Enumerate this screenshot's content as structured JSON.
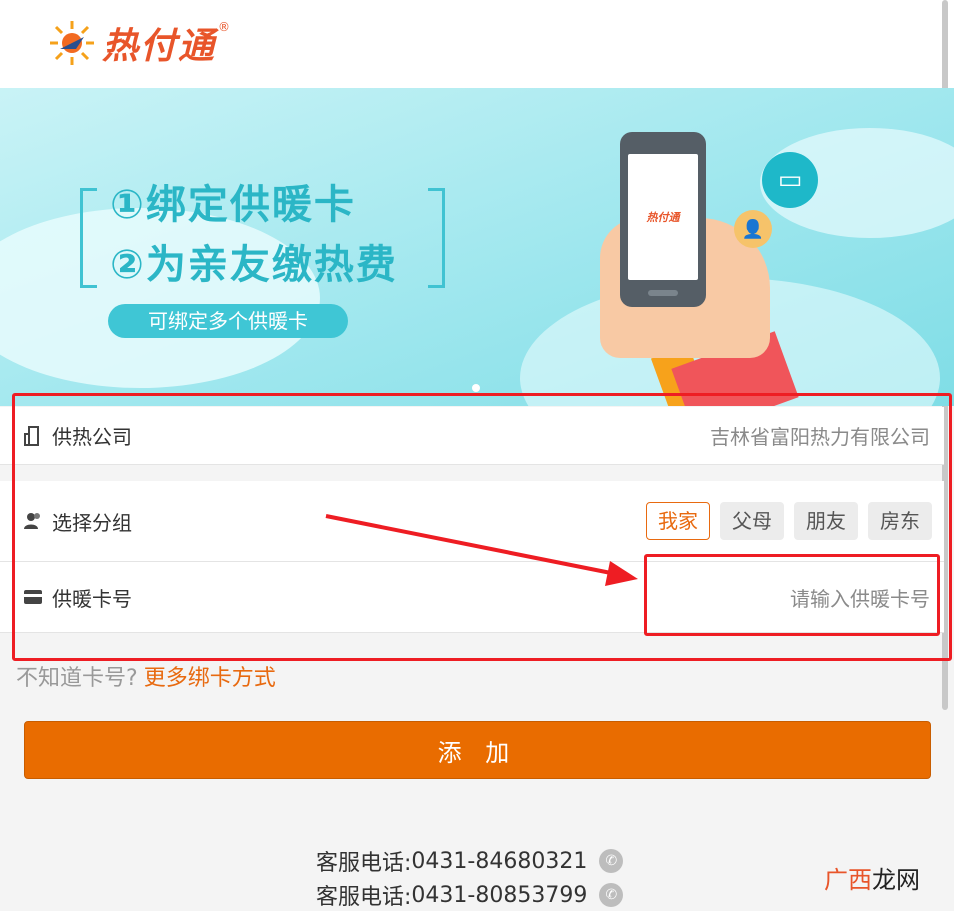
{
  "header": {
    "logo_text": "热付通",
    "logo_reg": "®"
  },
  "banner": {
    "line1": "①绑定供暖卡",
    "line2": "②为亲友缴热费",
    "pill": "可绑定多个供暖卡",
    "phone_logo": "热付通"
  },
  "form": {
    "company": {
      "label": "供热公司",
      "value": "吉林省富阳热力有限公司",
      "icon": "building-icon"
    },
    "group": {
      "label": "选择分组",
      "icon": "users-icon",
      "options": [
        "我家",
        "父母",
        "朋友",
        "房东"
      ],
      "selected": "我家"
    },
    "card": {
      "label": "供暖卡号",
      "placeholder": "请输入供暖卡号",
      "icon": "card-icon"
    }
  },
  "hint": {
    "text": "不知道卡号?",
    "link": "更多绑卡方式"
  },
  "add_button": "添 加",
  "service": [
    {
      "label": "客服电话:",
      "number": "0431-84680321"
    },
    {
      "label": "客服电话:",
      "number": "0431-80853799"
    }
  ],
  "watermark": {
    "part1": "广西",
    "part2": "龙网"
  },
  "colors": {
    "accent": "#e96c00",
    "annotation": "#ee1d23",
    "banner": "#9fe7ee"
  }
}
